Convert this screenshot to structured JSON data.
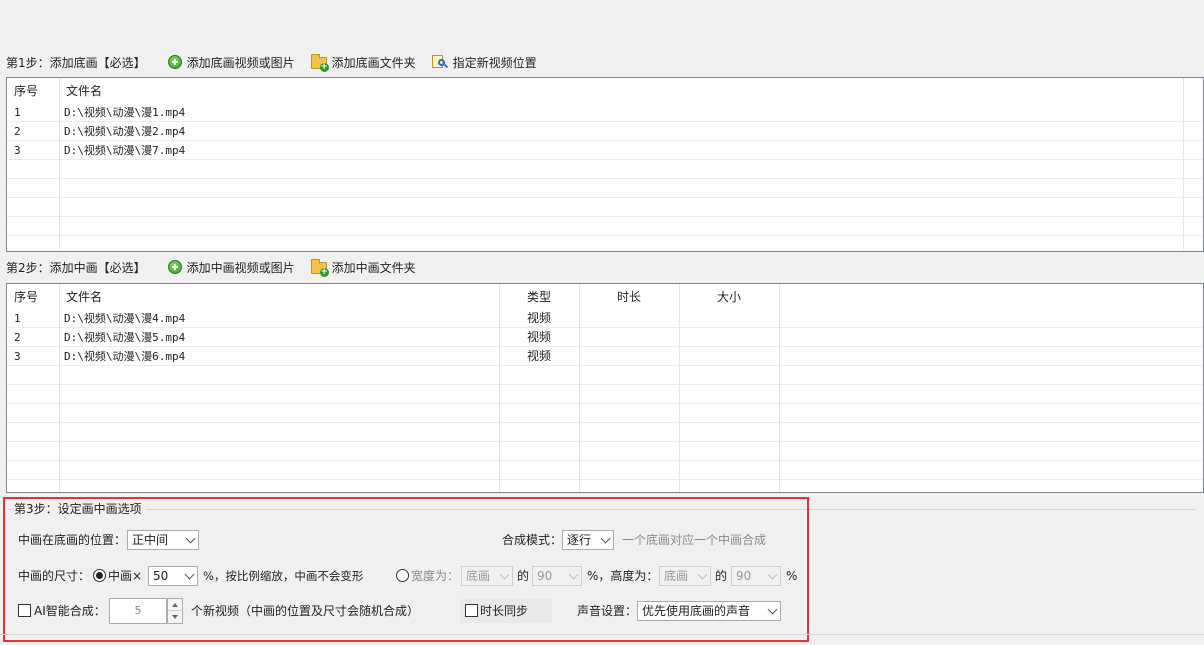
{
  "step1": {
    "label": "第1步：添加底画【必选】",
    "add_video_label": "添加底画视频或图片",
    "add_folder_label": "添加底画文件夹",
    "set_location_label": "指定新视频位置",
    "columns": [
      "序号",
      "文件名"
    ],
    "rows": [
      {
        "index": "1",
        "name": "D:\\视频\\动漫\\漫1.mp4"
      },
      {
        "index": "2",
        "name": "D:\\视频\\动漫\\漫2.mp4"
      },
      {
        "index": "3",
        "name": "D:\\视频\\动漫\\漫7.mp4"
      }
    ]
  },
  "step2": {
    "label": "第2步：添加中画【必选】",
    "add_video_label": "添加中画视频或图片",
    "add_folder_label": "添加中画文件夹",
    "columns": [
      "序号",
      "文件名",
      "类型",
      "时长",
      "大小"
    ],
    "rows": [
      {
        "index": "1",
        "name": "D:\\视频\\动漫\\漫4.mp4",
        "type": "视频"
      },
      {
        "index": "2",
        "name": "D:\\视频\\动漫\\漫5.mp4",
        "type": "视频"
      },
      {
        "index": "3",
        "name": "D:\\视频\\动漫\\漫6.mp4",
        "type": "视频"
      }
    ]
  },
  "step3": {
    "label": "第3步：设定画中画选项",
    "position_label": "中画在底画的位置：",
    "position_value": "正中间",
    "mode_label": "合成模式：",
    "mode_value": "逐行",
    "mode_hint": "一个底画对应一个中画合成",
    "size_label": "中画的尺寸：",
    "scale_option_label": "中画×",
    "scale_value": "50",
    "scale_suffix": "%，按比例缩放，中画不会变形",
    "width_option_label": "宽度为：",
    "width_ref_value": "底画",
    "of_label_1": "的",
    "width_percent_value": "90",
    "height_label": "%，高度为：",
    "height_ref_value": "底画",
    "of_label_2": "的",
    "height_percent_value": "90",
    "percent_sign": "%",
    "ai_label": "AI智能合成：",
    "ai_count": "5",
    "ai_suffix": "个新视频（中画的位置及尺寸会随机合成）",
    "duration_sync_label": "时长同步",
    "audio_label": "声音设置：",
    "audio_value": "优先使用底画的声音"
  },
  "colors": {
    "highlight_border": "#e0343c",
    "grid_border": "#828790",
    "background": "#f0f0f0"
  }
}
